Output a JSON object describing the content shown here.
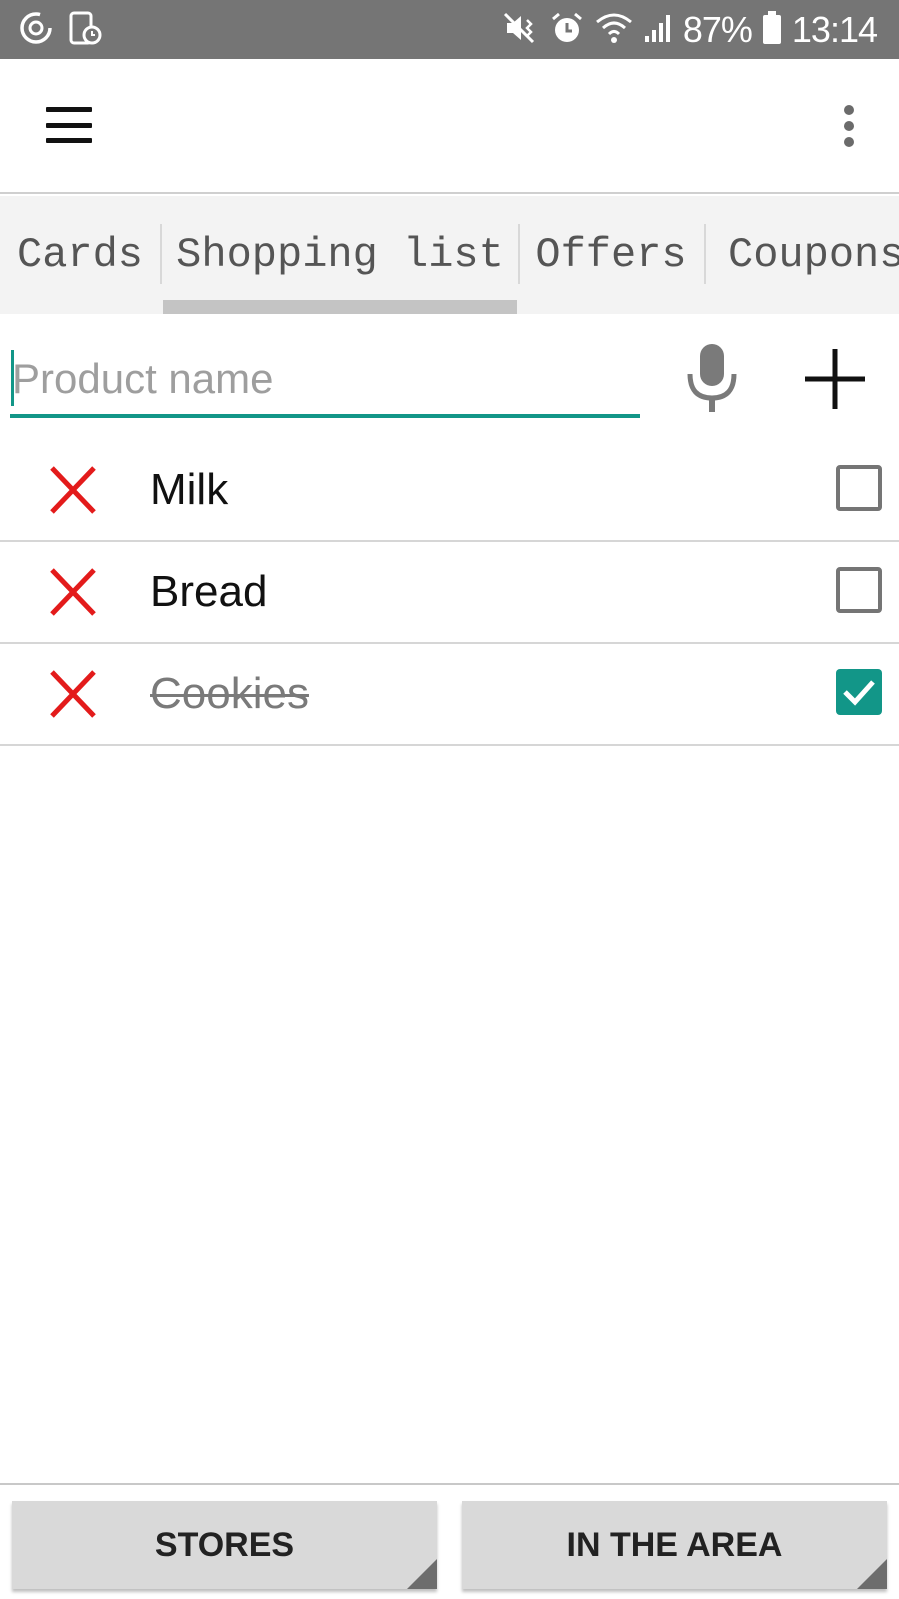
{
  "status_bar": {
    "battery": "87%",
    "time": "13:14",
    "left_icons": [
      "sync-icon",
      "screen-timer-icon"
    ],
    "right_icons": [
      "mute-vibrate-icon",
      "alarm-icon",
      "wifi-icon",
      "signal-icon",
      "battery-icon"
    ]
  },
  "toolbar": {
    "menu_icon": "hamburger-menu-icon",
    "overflow_icon": "more-vert-icon"
  },
  "tabs": [
    {
      "label": "Cards",
      "selected": false
    },
    {
      "label": "Shopping list",
      "selected": true
    },
    {
      "label": "Offers",
      "selected": false
    },
    {
      "label": "Coupons",
      "selected": false
    }
  ],
  "input": {
    "placeholder": "Product name",
    "value": ""
  },
  "items": [
    {
      "name": "Milk",
      "checked": false
    },
    {
      "name": "Bread",
      "checked": false
    },
    {
      "name": "Cookies",
      "checked": true
    }
  ],
  "bottom_buttons": {
    "stores": "STORES",
    "in_the_area": "IN THE AREA"
  },
  "colors": {
    "accent": "#129688",
    "delete": "#e31b1b",
    "status_bar": "#757575"
  }
}
